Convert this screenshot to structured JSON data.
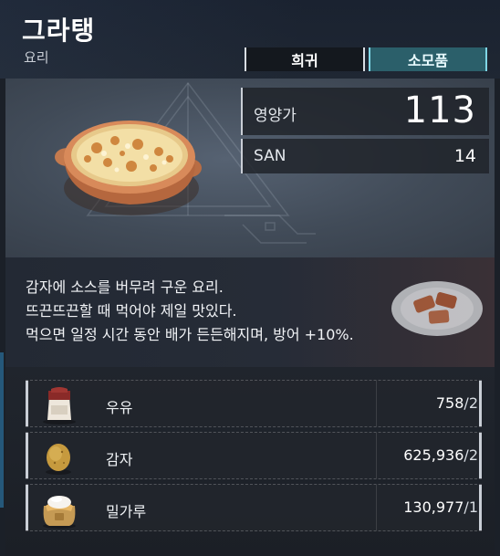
{
  "item": {
    "name": "그라탱",
    "category": "요리",
    "rarity": "희귀",
    "type": "소모품"
  },
  "stats": {
    "nutrition_label": "영양가",
    "nutrition_value": "113",
    "san_label": "SAN",
    "san_value": "14"
  },
  "description": [
    "감자에 소스를 버무려 구운 요리.",
    "뜨끈뜨끈할 때 먹어야 제일 맛있다.",
    "먹으면 일정 시간 동안 배가 든든해지며, 방어 +10%."
  ],
  "materials": [
    {
      "name": "우유",
      "owned": "758",
      "required": "/2",
      "icon": "milk-icon"
    },
    {
      "name": "감자",
      "owned": "625,936",
      "required": "/2",
      "icon": "potato-icon"
    },
    {
      "name": "밀가루",
      "owned": "130,977",
      "required": "/1",
      "icon": "flour-icon"
    }
  ],
  "colors": {
    "type_tag_bg": "#2b5f6a",
    "type_tag_border": "#7fd6e6",
    "panel_bg": "#1b2028"
  }
}
